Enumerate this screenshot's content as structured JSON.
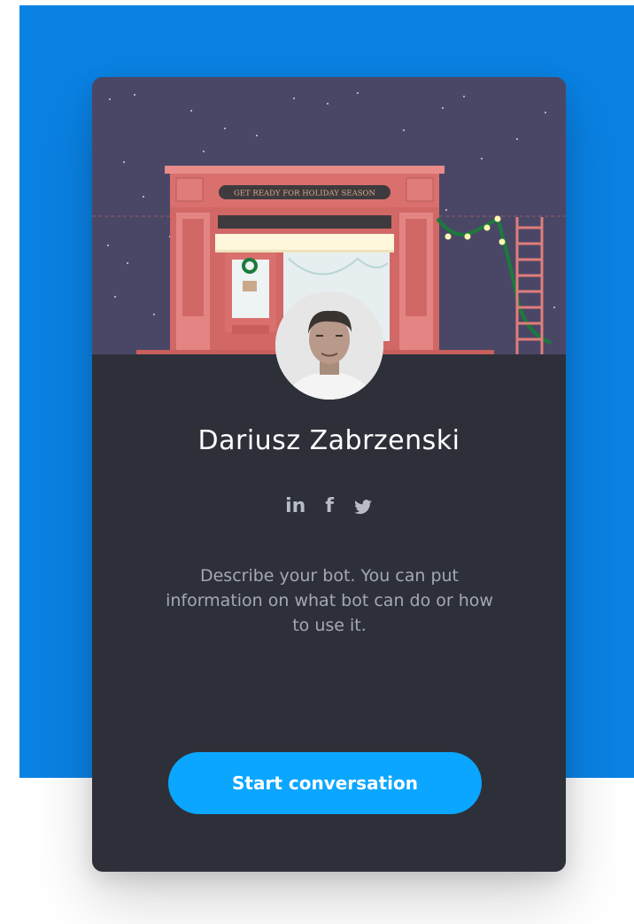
{
  "hero": {
    "sign_text": "GET READY FOR HOLIDAY SEASON"
  },
  "profile": {
    "name": "Dariusz Zabrzenski"
  },
  "socials": [
    {
      "label": "in",
      "icon": "linkedin-icon"
    },
    {
      "label": "f",
      "icon": "facebook-icon"
    },
    {
      "label": "",
      "icon": "twitter-icon"
    }
  ],
  "description": "Describe your bot. You can put information on what bot can do or how to use it.",
  "cta": {
    "label": "Start conversation"
  },
  "colors": {
    "page_accent": "#0a82e4",
    "card_bg": "#2d3039",
    "hero_bg": "#4a4766",
    "button": "#0ba6ff",
    "store": "#d9706e"
  }
}
